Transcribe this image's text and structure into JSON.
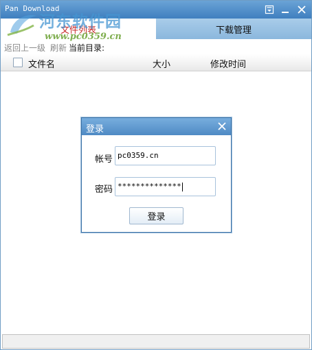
{
  "window": {
    "title": "Pan Download",
    "controls": {
      "menu": "menu-icon",
      "minimize": "minimize-icon",
      "close": "close-icon"
    }
  },
  "watermark": {
    "site_name": "河东软件园",
    "url": "www.pc0359.cn"
  },
  "tabs": [
    {
      "label": "文件列表",
      "active": true
    },
    {
      "label": "下载管理",
      "active": false
    }
  ],
  "toolbar": {
    "back_label": "返回上一级",
    "refresh_label": "刷新",
    "current_dir_label": "当前目录:"
  },
  "file_table": {
    "columns": [
      "文件名",
      "大小",
      "修改时间"
    ],
    "rows": []
  },
  "login_dialog": {
    "title": "登录",
    "account_label": "帐号",
    "account_value": "pc0359.cn",
    "password_label": "密码",
    "password_value": "**************",
    "submit_label": "登录"
  },
  "colors": {
    "title_bar": "#4f8ac4",
    "active_tab_text": "#c62828",
    "inactive_tab_bg": "#97bfe1"
  }
}
